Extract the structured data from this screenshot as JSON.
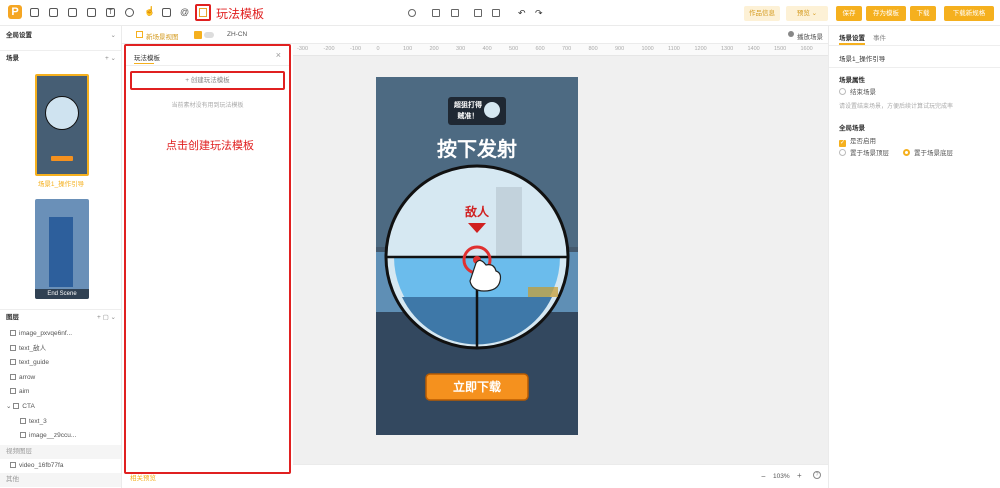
{
  "toolbar": {
    "annotation_label": "玩法模板",
    "btn_preview": "作品信息",
    "btn_settings": "预览",
    "btn_save": "保存",
    "btn_save_template": "存为模板",
    "btn_download": "下载",
    "btn_download_more": "下载新规格"
  },
  "left": {
    "global_settings": "全局设置",
    "scenes_title": "场景",
    "scenes": [
      {
        "label": "场景1_操作引导"
      },
      {
        "label": "End Scene"
      }
    ],
    "layers_title": "图层",
    "layers": [
      "image_pxvqe6nf...",
      "text_敌人",
      "text_guide",
      "arrow",
      "aim",
      "CTA",
      "text_3",
      "image__z9ccu..."
    ],
    "video_section": "视频图层",
    "video_item": "video_16fb77fa",
    "other_section": "其他"
  },
  "template_panel": {
    "title": "玩法模板",
    "create_button": "+ 创建玩法模板",
    "empty_text": "当前素材没有用到玩法模板",
    "annotation": "点击创建玩法模板"
  },
  "canvas": {
    "toolstrip_label": "新场景视图",
    "language": "ZH-CN",
    "play_scene": "播放场景",
    "ruler_ticks": [
      "-300",
      "-200",
      "-100",
      "0",
      "100",
      "200",
      "300",
      "400",
      "500",
      "600",
      "700",
      "800",
      "900",
      "1000",
      "1100",
      "1200",
      "1300",
      "1400",
      "1500",
      "1600"
    ],
    "zoom": "103%",
    "bottom_left": "相关预览"
  },
  "game": {
    "badge_line1": "超狙打得",
    "badge_line2": "贼准！",
    "headline": "按下发射",
    "enemy_label": "敌人",
    "cta_label": "立即下载"
  },
  "right": {
    "tab_scene_settings": "场景设置",
    "tab_events": "事件",
    "scene_name": "场景1_操作引导",
    "scene_props_title": "场景属性",
    "end_scene": "结束场景",
    "end_scene_hint": "请设置结束场景，方便后续计算试玩完成率",
    "global_scene_title": "全局场景",
    "enable": "是否启用",
    "top_layer": "置于场景顶层",
    "bottom_layer": "置于场景底层"
  },
  "colors": {
    "accent": "#f5b01e",
    "annotation_red": "#e02020"
  }
}
